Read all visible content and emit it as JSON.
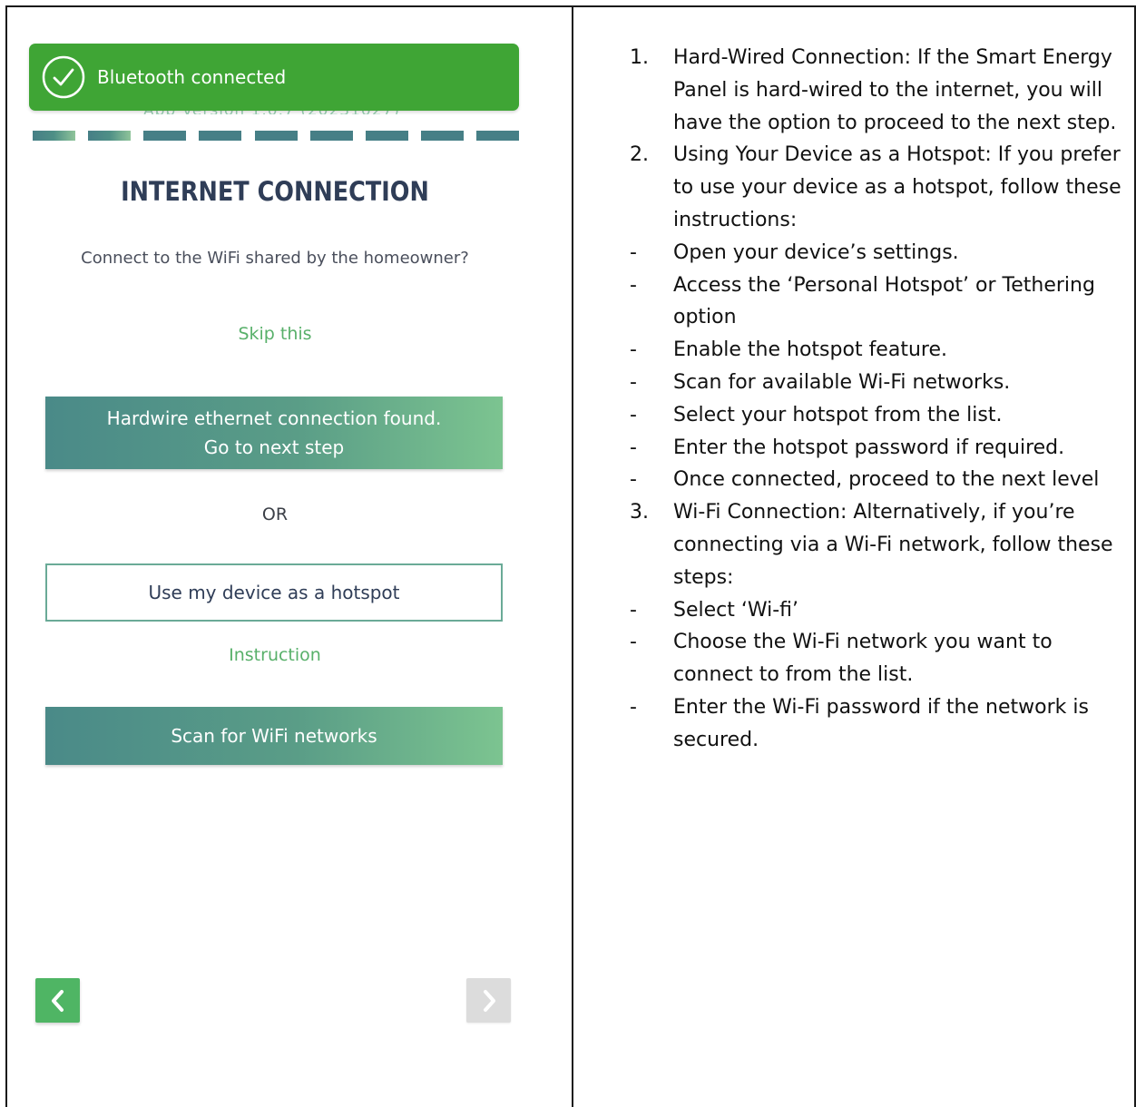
{
  "phone": {
    "toast": {
      "text": "Bluetooth connected",
      "icon": "check-circle-icon",
      "color": "#3fa535"
    },
    "progress": {
      "segments_total": 9,
      "segments_completed": 2,
      "completed_color": "#4e8f86",
      "pending_color": "#467f86"
    },
    "title": "INTERNET CONNECTION",
    "subtitle": "Connect to the WiFi shared by the homeowner?",
    "skip_label": "Skip this",
    "hardwire_button": {
      "line1": "Hardwire ethernet connection found.",
      "line2": "Go to next step"
    },
    "or_label": "OR",
    "hotspot_button_label": "Use my device as a hotspot",
    "instruction_link": "Instruction",
    "scan_button_label": "Scan for WiFi networks",
    "nav": {
      "back_icon": "chevron-left-icon",
      "next_icon": "chevron-right-icon",
      "back_color": "#4fb564",
      "next_color": "#dcdcdc"
    }
  },
  "instructions": [
    {
      "marker": "1.",
      "text": "Hard-Wired Connection: If the Smart Energy Panel is hard-wired to the internet, you will have the option to proceed to the next step."
    },
    {
      "marker": "2.",
      "text": "Using Your Device as a Hotspot: If you prefer to use your device as a hotspot, follow these instructions:"
    },
    {
      "marker": "-",
      "text": "Open your device’s settings."
    },
    {
      "marker": "-",
      "text": "Access the ‘Personal Hotspot’ or Tethering option"
    },
    {
      "marker": "-",
      "text": "Enable the hotspot feature."
    },
    {
      "marker": "-",
      "text": "Scan for available Wi-Fi networks."
    },
    {
      "marker": "-",
      "text": "Select your hotspot from the list."
    },
    {
      "marker": "-",
      "text": "Enter the hotspot password if required."
    },
    {
      "marker": "-",
      "text": "Once connected, proceed to the next level"
    },
    {
      "marker": "3.",
      "text": "Wi-Fi Connection: Alternatively, if you’re connecting via a Wi-Fi network, follow these steps:"
    },
    {
      "marker": "-",
      "text": "Select ‘Wi-fi’"
    },
    {
      "marker": "-",
      "text": "Choose the Wi-Fi network you want to connect to from the list."
    },
    {
      "marker": "-",
      "text": "Enter the Wi-Fi password if the network is secured."
    }
  ]
}
